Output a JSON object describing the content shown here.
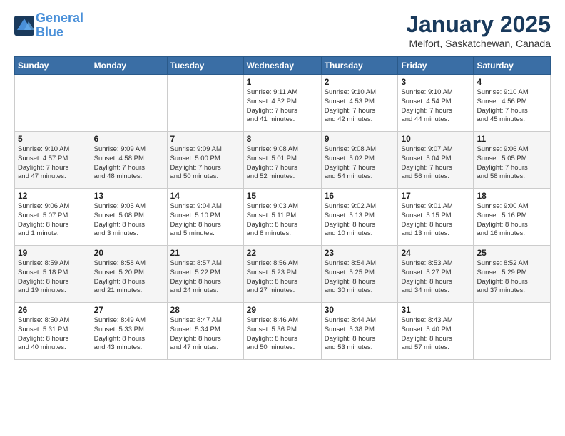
{
  "header": {
    "logo_line1": "General",
    "logo_line2": "Blue",
    "month": "January 2025",
    "location": "Melfort, Saskatchewan, Canada"
  },
  "weekdays": [
    "Sunday",
    "Monday",
    "Tuesday",
    "Wednesday",
    "Thursday",
    "Friday",
    "Saturday"
  ],
  "weeks": [
    [
      {
        "day": "",
        "info": ""
      },
      {
        "day": "",
        "info": ""
      },
      {
        "day": "",
        "info": ""
      },
      {
        "day": "1",
        "info": "Sunrise: 9:11 AM\nSunset: 4:52 PM\nDaylight: 7 hours\nand 41 minutes."
      },
      {
        "day": "2",
        "info": "Sunrise: 9:10 AM\nSunset: 4:53 PM\nDaylight: 7 hours\nand 42 minutes."
      },
      {
        "day": "3",
        "info": "Sunrise: 9:10 AM\nSunset: 4:54 PM\nDaylight: 7 hours\nand 44 minutes."
      },
      {
        "day": "4",
        "info": "Sunrise: 9:10 AM\nSunset: 4:56 PM\nDaylight: 7 hours\nand 45 minutes."
      }
    ],
    [
      {
        "day": "5",
        "info": "Sunrise: 9:10 AM\nSunset: 4:57 PM\nDaylight: 7 hours\nand 47 minutes."
      },
      {
        "day": "6",
        "info": "Sunrise: 9:09 AM\nSunset: 4:58 PM\nDaylight: 7 hours\nand 48 minutes."
      },
      {
        "day": "7",
        "info": "Sunrise: 9:09 AM\nSunset: 5:00 PM\nDaylight: 7 hours\nand 50 minutes."
      },
      {
        "day": "8",
        "info": "Sunrise: 9:08 AM\nSunset: 5:01 PM\nDaylight: 7 hours\nand 52 minutes."
      },
      {
        "day": "9",
        "info": "Sunrise: 9:08 AM\nSunset: 5:02 PM\nDaylight: 7 hours\nand 54 minutes."
      },
      {
        "day": "10",
        "info": "Sunrise: 9:07 AM\nSunset: 5:04 PM\nDaylight: 7 hours\nand 56 minutes."
      },
      {
        "day": "11",
        "info": "Sunrise: 9:06 AM\nSunset: 5:05 PM\nDaylight: 7 hours\nand 58 minutes."
      }
    ],
    [
      {
        "day": "12",
        "info": "Sunrise: 9:06 AM\nSunset: 5:07 PM\nDaylight: 8 hours\nand 1 minute."
      },
      {
        "day": "13",
        "info": "Sunrise: 9:05 AM\nSunset: 5:08 PM\nDaylight: 8 hours\nand 3 minutes."
      },
      {
        "day": "14",
        "info": "Sunrise: 9:04 AM\nSunset: 5:10 PM\nDaylight: 8 hours\nand 5 minutes."
      },
      {
        "day": "15",
        "info": "Sunrise: 9:03 AM\nSunset: 5:11 PM\nDaylight: 8 hours\nand 8 minutes."
      },
      {
        "day": "16",
        "info": "Sunrise: 9:02 AM\nSunset: 5:13 PM\nDaylight: 8 hours\nand 10 minutes."
      },
      {
        "day": "17",
        "info": "Sunrise: 9:01 AM\nSunset: 5:15 PM\nDaylight: 8 hours\nand 13 minutes."
      },
      {
        "day": "18",
        "info": "Sunrise: 9:00 AM\nSunset: 5:16 PM\nDaylight: 8 hours\nand 16 minutes."
      }
    ],
    [
      {
        "day": "19",
        "info": "Sunrise: 8:59 AM\nSunset: 5:18 PM\nDaylight: 8 hours\nand 19 minutes."
      },
      {
        "day": "20",
        "info": "Sunrise: 8:58 AM\nSunset: 5:20 PM\nDaylight: 8 hours\nand 21 minutes."
      },
      {
        "day": "21",
        "info": "Sunrise: 8:57 AM\nSunset: 5:22 PM\nDaylight: 8 hours\nand 24 minutes."
      },
      {
        "day": "22",
        "info": "Sunrise: 8:56 AM\nSunset: 5:23 PM\nDaylight: 8 hours\nand 27 minutes."
      },
      {
        "day": "23",
        "info": "Sunrise: 8:54 AM\nSunset: 5:25 PM\nDaylight: 8 hours\nand 30 minutes."
      },
      {
        "day": "24",
        "info": "Sunrise: 8:53 AM\nSunset: 5:27 PM\nDaylight: 8 hours\nand 34 minutes."
      },
      {
        "day": "25",
        "info": "Sunrise: 8:52 AM\nSunset: 5:29 PM\nDaylight: 8 hours\nand 37 minutes."
      }
    ],
    [
      {
        "day": "26",
        "info": "Sunrise: 8:50 AM\nSunset: 5:31 PM\nDaylight: 8 hours\nand 40 minutes."
      },
      {
        "day": "27",
        "info": "Sunrise: 8:49 AM\nSunset: 5:33 PM\nDaylight: 8 hours\nand 43 minutes."
      },
      {
        "day": "28",
        "info": "Sunrise: 8:47 AM\nSunset: 5:34 PM\nDaylight: 8 hours\nand 47 minutes."
      },
      {
        "day": "29",
        "info": "Sunrise: 8:46 AM\nSunset: 5:36 PM\nDaylight: 8 hours\nand 50 minutes."
      },
      {
        "day": "30",
        "info": "Sunrise: 8:44 AM\nSunset: 5:38 PM\nDaylight: 8 hours\nand 53 minutes."
      },
      {
        "day": "31",
        "info": "Sunrise: 8:43 AM\nSunset: 5:40 PM\nDaylight: 8 hours\nand 57 minutes."
      },
      {
        "day": "",
        "info": ""
      }
    ]
  ]
}
